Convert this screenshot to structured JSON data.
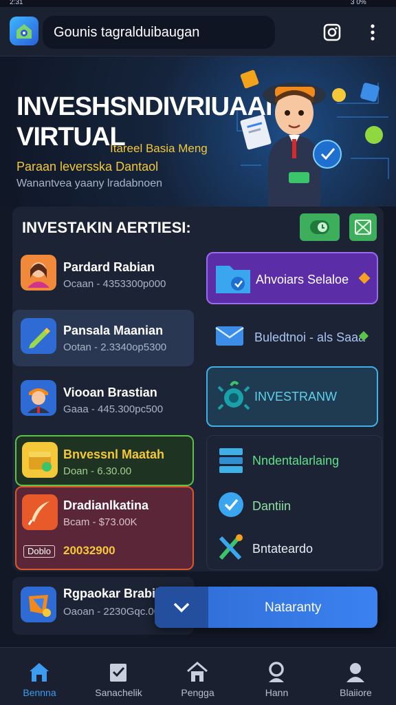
{
  "status": {
    "time": "2:31",
    "battery": "3 0%"
  },
  "header": {
    "search_text": "Gounis tagralduibaugan"
  },
  "hero": {
    "title_line1": "INVESHSNDIVRIUAAI",
    "title_line2": "VIRTUAL",
    "sub1": "Itareel Basia Meng",
    "sub2": "Paraan leversska Dantaol",
    "sub3": "Wanantvea yaany lradabnoen"
  },
  "section": {
    "title": "INVESTAKIN AERTIESI:"
  },
  "left_cards": [
    {
      "name": "Pardard Rabian",
      "amount": "Ocaan - 4353300p000"
    },
    {
      "name": "Pansala Maanian",
      "amount": "Ootan - 2.3340op5300"
    },
    {
      "name": "Viooan Brastian",
      "amount": "Gaaa - 445.300pc500"
    },
    {
      "name": "Bnvessnl Maatah",
      "amount": "Doan - 6.30.00"
    },
    {
      "name": "Dradianlkatina",
      "amount": "Bcam - $73.00K",
      "tag": "Doblo",
      "value": "20032900"
    },
    {
      "name": "Rgpaokar Brabiier",
      "amount": "Oaoan - 2230Gqc.000"
    }
  ],
  "right_cards": [
    {
      "label": "Ahvoiars Selaloe"
    },
    {
      "label": "Buledtnoi - als Saaa"
    },
    {
      "label": "INVESTRANW"
    },
    {
      "label": "Nndentalarlaing"
    },
    {
      "label": "Dantiin"
    },
    {
      "label": "Bntateardo"
    }
  ],
  "floating_button": {
    "label": "Nataranty"
  },
  "nav": [
    {
      "label": "Bennna"
    },
    {
      "label": "Sanachelik"
    },
    {
      "label": "Pengga"
    },
    {
      "label": "Hann"
    },
    {
      "label": "Blaiiore"
    }
  ],
  "colors": {
    "accent": "#3b82f0",
    "gold": "#f4c838",
    "green": "#36b46a",
    "purple": "#5b2ea8"
  }
}
